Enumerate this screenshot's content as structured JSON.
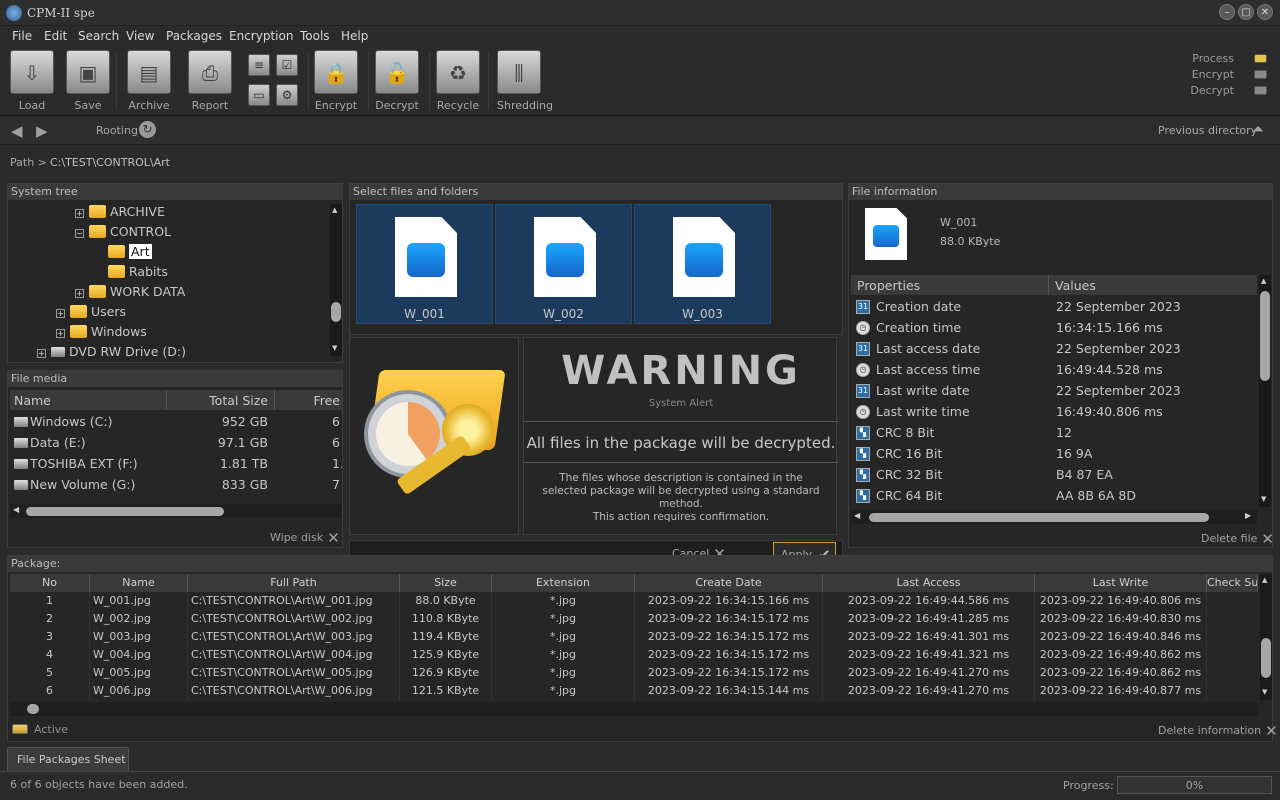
{
  "app": {
    "title": "CPM-II spe"
  },
  "window_controls": {
    "min": "–",
    "max": "□",
    "close": "✕"
  },
  "menu": [
    "File",
    "Edit",
    "Search",
    "View",
    "Packages",
    "Encryption",
    "Tools",
    "Help"
  ],
  "toolbar": {
    "load": "Load",
    "save": "Save",
    "archive": "Archive",
    "report": "Report",
    "encrypt": "Encrypt",
    "decrypt": "Decrypt",
    "recycle": "Recycle",
    "shredding": "Shredding"
  },
  "status_indicators": {
    "process": "Process",
    "encrypt": "Encrypt",
    "decrypt": "Decrypt",
    "process_color": "#e8c44a",
    "encrypt_color": "#8a8a8a",
    "decrypt_color": "#8a8a8a"
  },
  "nav": {
    "rooting": "Rooting",
    "previous_directory": "Previous directory"
  },
  "path": {
    "label": "Path >",
    "value": "C:\\TEST\\CONTROL\\Art"
  },
  "system_tree": {
    "title": "System tree",
    "items": [
      {
        "label": "ARCHIVE",
        "indent": 3,
        "expander": "+"
      },
      {
        "label": "CONTROL",
        "indent": 3,
        "expander": "−"
      },
      {
        "label": "Art",
        "indent": 4,
        "expander": "",
        "selected": true
      },
      {
        "label": "Rabits",
        "indent": 4,
        "expander": ""
      },
      {
        "label": "WORK DATA",
        "indent": 3,
        "expander": "+"
      },
      {
        "label": "Users",
        "indent": 2,
        "expander": "+"
      },
      {
        "label": "Windows",
        "indent": 2,
        "expander": "+"
      },
      {
        "label": "DVD RW Drive (D:)",
        "indent": 1,
        "expander": "+",
        "drive": true
      }
    ]
  },
  "file_media": {
    "title": "File media",
    "columns": [
      "Name",
      "Total Size",
      "Free"
    ],
    "rows": [
      {
        "name": "Windows  (C:)",
        "total": "952 GB",
        "free": "6"
      },
      {
        "name": "Data (E:)",
        "total": "97.1 GB",
        "free": "6"
      },
      {
        "name": "TOSHIBA EXT (F:)",
        "total": "1.81 TB",
        "free": "1."
      },
      {
        "name": "New Volume (G:)",
        "total": "833 GB",
        "free": "7"
      }
    ],
    "wipe": "Wipe disk"
  },
  "select_files": {
    "title": "Select files and folders",
    "files": [
      "W_001",
      "W_002",
      "W_003"
    ]
  },
  "warning": {
    "title": "WARNING",
    "subtitle": "System Alert",
    "headline": "All files in the package will be decrypted.",
    "body": "The files whose description is contained in the selected package will be decrypted using a standard method.",
    "confirm": "This action requires confirmation.",
    "cancel": "Cancel",
    "apply": "Apply"
  },
  "file_info": {
    "title": "File information",
    "name": "W_001",
    "size": "88.0 KByte",
    "columns": [
      "Properties",
      "Values"
    ],
    "rows": [
      {
        "icon": "calendar-icon",
        "prop": "Creation date",
        "value": "22 September 2023"
      },
      {
        "icon": "clock-icon",
        "prop": "Creation time",
        "value": "16:34:15.166 ms"
      },
      {
        "icon": "calendar-icon",
        "prop": "Last access date",
        "value": "22 September 2023"
      },
      {
        "icon": "clock-icon",
        "prop": "Last access time",
        "value": "16:49:44.528 ms"
      },
      {
        "icon": "calendar-icon",
        "prop": "Last write date",
        "value": "22 September 2023"
      },
      {
        "icon": "clock-icon",
        "prop": "Last write time",
        "value": "16:49:40.806 ms"
      },
      {
        "icon": "crc-icon",
        "prop": "CRC 8 Bit",
        "value": "12"
      },
      {
        "icon": "crc-icon",
        "prop": "CRC 16 Bit",
        "value": "16 9A"
      },
      {
        "icon": "crc-icon",
        "prop": "CRC 32 Bit",
        "value": "B4 87 EA"
      },
      {
        "icon": "crc-icon",
        "prop": "CRC 64 Bit",
        "value": "AA 8B 6A 8D"
      }
    ],
    "delete": "Delete file"
  },
  "package": {
    "title": "Package:",
    "columns": [
      "No",
      "Name",
      "Full Path",
      "Size",
      "Extension",
      "Create Date",
      "Last Access",
      "Last Write",
      "Check Sum"
    ],
    "rows": [
      {
        "no": "1",
        "name": "W_001.jpg",
        "path": "C:\\TEST\\CONTROL\\Art\\W_001.jpg",
        "size": "88.0 KByte",
        "ext": "*.jpg",
        "create": "2023-09-22 16:34:15.166 ms",
        "access": "2023-09-22 16:49:44.586 ms",
        "write": "2023-09-22 16:49:40.806 ms"
      },
      {
        "no": "2",
        "name": "W_002.jpg",
        "path": "C:\\TEST\\CONTROL\\Art\\W_002.jpg",
        "size": "110.8 KByte",
        "ext": "*.jpg",
        "create": "2023-09-22 16:34:15.172 ms",
        "access": "2023-09-22 16:49:41.285 ms",
        "write": "2023-09-22 16:49:40.830 ms"
      },
      {
        "no": "3",
        "name": "W_003.jpg",
        "path": "C:\\TEST\\CONTROL\\Art\\W_003.jpg",
        "size": "119.4 KByte",
        "ext": "*.jpg",
        "create": "2023-09-22 16:34:15.172 ms",
        "access": "2023-09-22 16:49:41.301 ms",
        "write": "2023-09-22 16:49:40.846 ms"
      },
      {
        "no": "4",
        "name": "W_004.jpg",
        "path": "C:\\TEST\\CONTROL\\Art\\W_004.jpg",
        "size": "125.9 KByte",
        "ext": "*.jpg",
        "create": "2023-09-22 16:34:15.172 ms",
        "access": "2023-09-22 16:49:41.321 ms",
        "write": "2023-09-22 16:49:40.862 ms"
      },
      {
        "no": "5",
        "name": "W_005.jpg",
        "path": "C:\\TEST\\CONTROL\\Art\\W_005.jpg",
        "size": "126.9 KByte",
        "ext": "*.jpg",
        "create": "2023-09-22 16:34:15.172 ms",
        "access": "2023-09-22 16:49:41.270 ms",
        "write": "2023-09-22 16:49:40.862 ms"
      },
      {
        "no": "6",
        "name": "W_006.jpg",
        "path": "C:\\TEST\\CONTROL\\Art\\W_006.jpg",
        "size": "121.5 KByte",
        "ext": "*.jpg",
        "create": "2023-09-22 16:34:15.144 ms",
        "access": "2023-09-22 16:49:41.270 ms",
        "write": "2023-09-22 16:49:40.877 ms"
      }
    ],
    "active": "Active",
    "delete_info": "Delete information"
  },
  "tabs": [
    "File Packages Sheet"
  ],
  "statusbar": {
    "message": "6 of 6 objects have been added.",
    "progress_label": "Progress:",
    "progress_value": "0%"
  }
}
